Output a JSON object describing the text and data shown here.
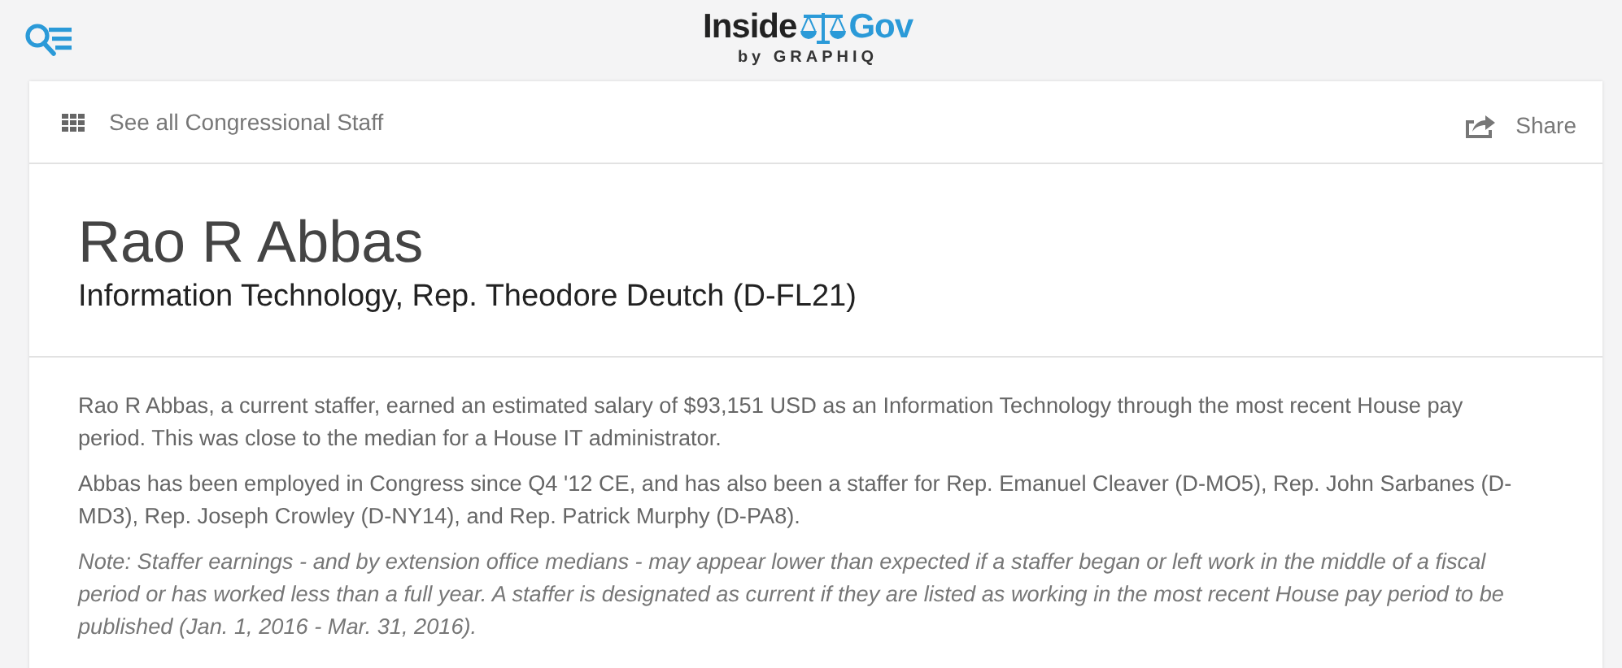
{
  "header": {
    "logo": {
      "brand_left": "Inside",
      "brand_right": "Gov",
      "byline": "by GRAPHIQ"
    }
  },
  "nav": {
    "back_link": "See all Congressional Staff",
    "share": "Share"
  },
  "profile": {
    "name": "Rao R Abbas",
    "subtitle": "Information Technology, Rep. Theodore Deutch (D-FL21)"
  },
  "paragraphs": [
    {
      "kind": "body",
      "text": "Rao R Abbas, a current staffer, earned an estimated salary of $93,151 USD as an Information Technology through the most recent House pay period. This was close to the median for a House IT administrator."
    },
    {
      "kind": "body",
      "text": "Abbas has been employed in Congress since Q4 '12 CE, and has also been a staffer for Rep. Emanuel Cleaver (D-MO5), Rep. John Sarbanes (D-MD3), Rep. Joseph Crowley (D-NY14), and Rep. Patrick Murphy (D-PA8)."
    },
    {
      "kind": "note",
      "text": "Note: Staffer earnings - and by extension office medians - may appear lower than expected if a staffer began or left work in the middle of a fiscal period or has worked less than a full year. A staffer is designated as current if they are listed as working in the most recent House pay period to be published (Jan. 1, 2016 - Mar. 31, 2016)."
    }
  ]
}
